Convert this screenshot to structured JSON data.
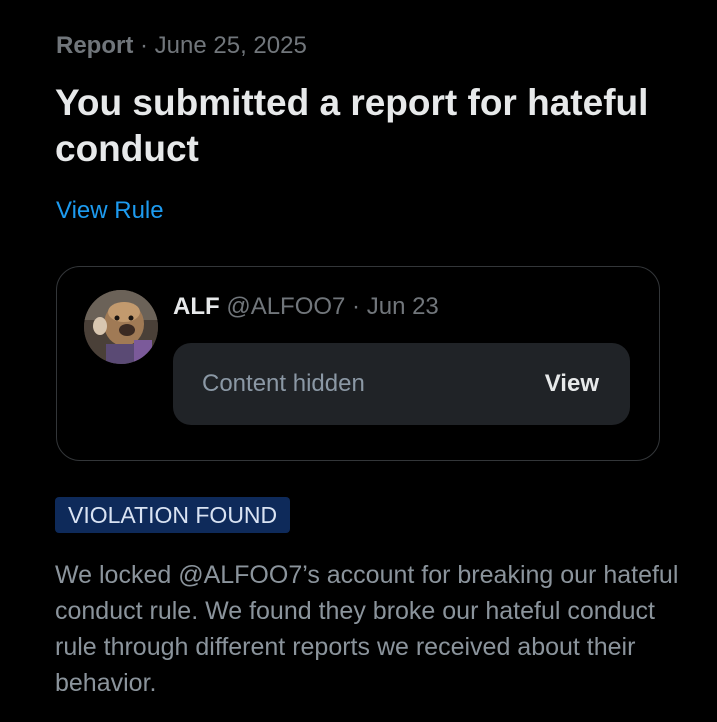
{
  "report": {
    "type_label": "Report",
    "separator": " · ",
    "date": "June 25, 2025",
    "title": "You submitted a report for hateful conduct",
    "view_rule_label": "View Rule"
  },
  "post": {
    "display_name": "ALF",
    "handle": "@ALFOO7",
    "separator": " · ",
    "date": "Jun 23",
    "hidden_label": "Content hidden",
    "view_label": "View"
  },
  "result": {
    "badge_label": "VIOLATION FOUND",
    "badge_color": "#0e2a5a",
    "message": "We locked @ALFOO7’s account for breaking our hateful conduct rule. We found they broke our hateful conduct rule through different reports we received about their behavior."
  },
  "colors": {
    "background": "#000000",
    "link": "#1d9bf0",
    "muted": "#71767b"
  }
}
